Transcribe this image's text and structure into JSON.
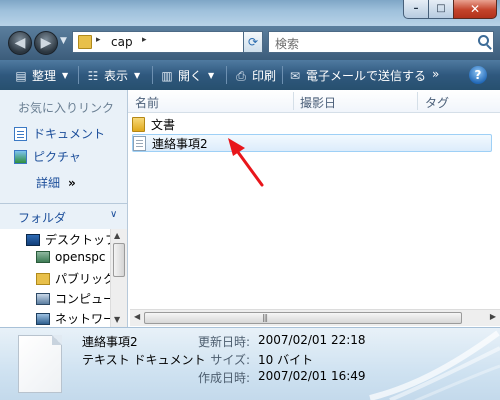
{
  "window": {
    "controls": {
      "minimize": "–",
      "maximize": "□",
      "close": "✕"
    }
  },
  "address_bar": {
    "path": "cap",
    "breadcrumb_sep": "▸",
    "search_placeholder": "検索",
    "back_icon": "back-arrow-icon",
    "forward_icon": "forward-arrow-icon",
    "refresh_icon": "refresh-icon",
    "search_icon": "search-icon"
  },
  "toolbar": {
    "organize": "整理",
    "view": "表示",
    "open": "開く",
    "print": "印刷",
    "email": "電子メールで送信する",
    "overflow": "»",
    "help": "?"
  },
  "left_pane": {
    "favorites_header": "お気に入りリンク",
    "favorites": [
      {
        "label": "ドキュメント",
        "icon": "documents-icon"
      },
      {
        "label": "ピクチャ",
        "icon": "pictures-icon"
      }
    ],
    "more_label": "詳細",
    "more_chevron": "»",
    "folders_header": "フォルダ",
    "folders_chevron": "∨",
    "tree": [
      {
        "label": "デスクトップ",
        "icon": "desktop-icon"
      },
      {
        "label": "openspc",
        "icon": "user-folder-icon"
      },
      {
        "label": "パブリック",
        "icon": "folder-icon"
      },
      {
        "label": "コンピュー",
        "icon": "computer-icon"
      },
      {
        "label": "ネットワー",
        "icon": "network-icon"
      }
    ]
  },
  "file_list": {
    "columns": [
      "名前",
      "撮影日",
      "タグ"
    ],
    "items": [
      {
        "name": "文書",
        "type": "folder",
        "selected": false
      },
      {
        "name": "連絡事項2",
        "type": "text",
        "selected": true
      }
    ]
  },
  "details_pane": {
    "name": "連絡事項2",
    "type": "テキスト ドキュメント",
    "fields": [
      {
        "label": "更新日時:",
        "value": "2007/02/01 22:18"
      },
      {
        "label": "サイズ:",
        "value": "10 バイト"
      },
      {
        "label": "作成日時:",
        "value": "2007/02/01 16:49"
      }
    ]
  },
  "colors": {
    "toolbar": "#2f587e",
    "link": "#1c4e9a",
    "selection_border": "#9ed0f6",
    "annotation_arrow": "#e8161b"
  }
}
